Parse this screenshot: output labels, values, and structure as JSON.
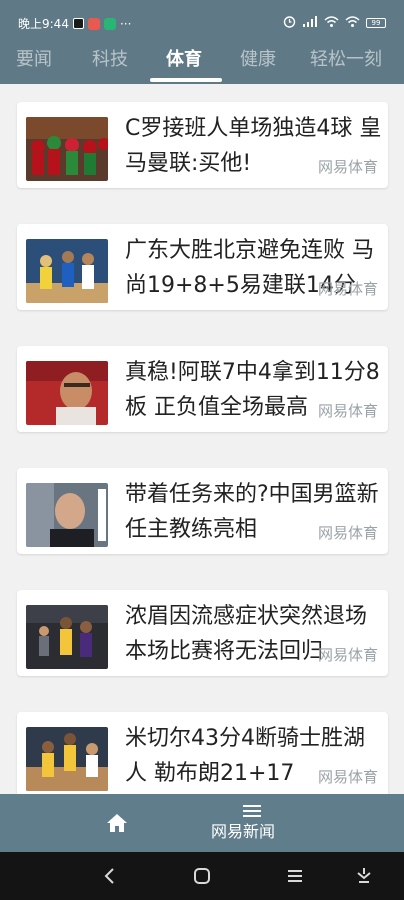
{
  "status": {
    "time": "晚上9:44",
    "more": "···",
    "battery": "99"
  },
  "tabs": [
    {
      "label": "要闻"
    },
    {
      "label": "科技"
    },
    {
      "label": "体育"
    },
    {
      "label": "健康"
    },
    {
      "label": "轻松一刻"
    }
  ],
  "active_tab": "体育",
  "news": [
    {
      "title": "C罗接班人单场独造4球 皇马曼联:买他!",
      "source": "网易体育"
    },
    {
      "title": "广东大胜北京避免连败 马尚19+8+5易建联14分",
      "source": "网易体育"
    },
    {
      "title": "真稳!阿联7中4拿到11分8板 正负值全场最高",
      "source": "网易体育"
    },
    {
      "title": "带着任务来的?中国男篮新任主教练亮相",
      "source": "网易体育"
    },
    {
      "title": "浓眉因流感症状突然退场 本场比赛将无法回归",
      "source": "网易体育"
    },
    {
      "title": "米切尔43分4断骑士胜湖人 勒布朗21+17",
      "source": "网易体育"
    }
  ],
  "bottom": {
    "app_name": "网易新闻"
  },
  "colors": {
    "topbar": "#5f7a86",
    "bottombar": "#607d8b",
    "sysnav": "#141414"
  },
  "icons": {
    "home": "home-icon",
    "menu": "menu-icon",
    "back": "back-icon",
    "overview": "home-circle-icon",
    "recents": "recents-icon",
    "notifications": "notification-icon"
  }
}
